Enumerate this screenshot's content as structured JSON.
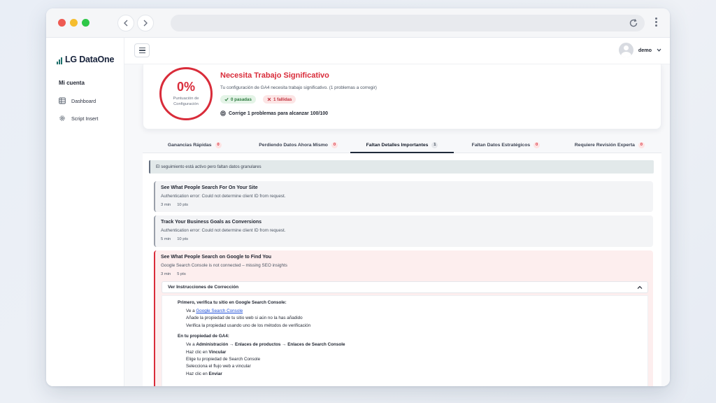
{
  "app": {
    "logo_text": "LG DataOne"
  },
  "sidebar": {
    "heading": "Mi cuenta",
    "items": [
      {
        "label": "Dashboard",
        "icon": "table-icon"
      },
      {
        "label": "Script Insert",
        "icon": "gear-icon"
      }
    ]
  },
  "topbar": {
    "username": "demo"
  },
  "score": {
    "percent": "0%",
    "ring_label": "Puntuación de Configuración",
    "title": "Necesita Trabajo Significativo",
    "description": "Tu configuración de GA4 necesita trabajo significativo. (1 problemas a corregir)",
    "passed_label": "0 pasadas",
    "failed_label": "1 fallidas",
    "fix_label": "Corrige 1 problemas para alcanzar 100/100"
  },
  "tabs": [
    {
      "label": "Ganancias Rápidas",
      "count": "0"
    },
    {
      "label": "Perdiendo Datos Ahora Mismo",
      "count": "0"
    },
    {
      "label": "Faltan Detalles Importantes",
      "count": "1"
    },
    {
      "label": "Faltan Datos Estratégicos",
      "count": "0"
    },
    {
      "label": "Requiere Revisión Experta",
      "count": "0"
    }
  ],
  "notice": "El seguimiento está activo pero faltan datos granulares",
  "issues": [
    {
      "title": "See What People Search For On Your Site",
      "desc": "Authentication error: Could not determine client ID from request.",
      "time": "3 min",
      "points": "10 pts"
    },
    {
      "title": "Track Your Business Goals as Conversions",
      "desc": "Authentication error: Could not determine client ID from request.",
      "time": "5 min",
      "points": "10 pts"
    },
    {
      "title": "See What People Search on Google to Find You",
      "desc": "Google Search Console is not connected – missing SEO insights",
      "time": "3 min",
      "points": "5 pts"
    }
  ],
  "instructions": {
    "toggle_label": "Ver Instrucciones de Corrección",
    "section1_heading": "Primero, verifica tu sitio en Google Search Console:",
    "s1_step1_prefix": "Ve a",
    "s1_step1_link": "Google Search Console",
    "s1_step2": "Añade la propiedad de tu sitio web si aún no la has añadido",
    "s1_step3": "Verifica la propiedad usando uno de los métodos de verificación",
    "section2_heading": "En tu propiedad de GA4:",
    "s2_step1_prefix": "Ve a",
    "s2_step1_bold": "Administración → Enlaces de productos → Enlaces de Search Console",
    "s2_step2_prefix": "Haz clic en",
    "s2_step2_bold": "Vincular",
    "s2_step3": "Elige tu propiedad de Search Console",
    "s2_step4": "Selecciona el flujo web a vincular",
    "s2_step5_prefix": "Haz clic en",
    "s2_step5_bold": "Enviar"
  },
  "colors": {
    "accent_red": "#d92c3a",
    "brand_teal": "#1f6f6b",
    "pass_green": "#2d7a3f"
  }
}
